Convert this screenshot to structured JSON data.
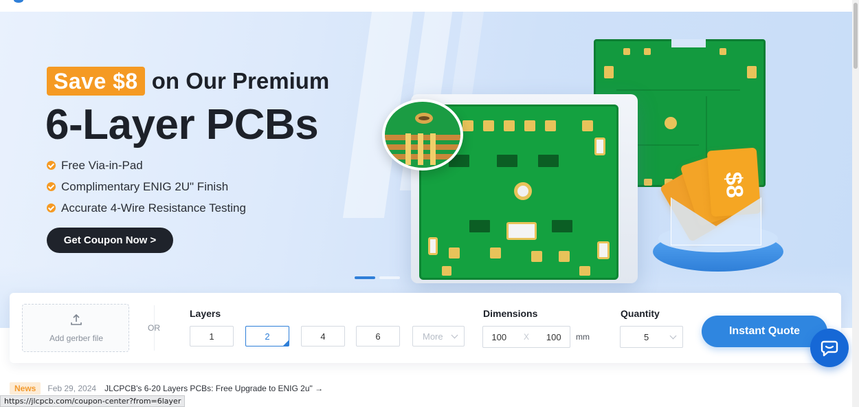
{
  "hero": {
    "badge": "Save $8",
    "headline_rest": "on Our Premium",
    "headline_main": "6-Layer PCBs",
    "features": [
      "Free Via-in-Pad",
      "Complimentary ENIG 2U\" Finish",
      "Accurate 4-Wire Resistance Testing"
    ],
    "cta_label": "Get Coupon Now >",
    "coupon_art_text": "$8"
  },
  "quote": {
    "upload_label": "Add gerber file",
    "or_label": "OR",
    "layers_label": "Layers",
    "layers": [
      "1",
      "2",
      "4",
      "6"
    ],
    "selected_layer": "2",
    "more_label": "More",
    "dimensions_label": "Dimensions",
    "dim_x": "100",
    "dim_sep": "X",
    "dim_y": "100",
    "unit": "mm",
    "quantity_label": "Quantity",
    "quantity": "5",
    "quote_button": "Instant Quote"
  },
  "news": {
    "badge": "News",
    "date": "Feb 29, 2024",
    "text": "JLCPCB's 6-20 Layers PCBs: Free Upgrade to ENIG 2u\" →"
  },
  "status_bar": {
    "url": "https://jlcpcb.com/coupon-center?from=6layer"
  },
  "colors": {
    "accent_orange": "#f59a23",
    "primary_blue": "#2f86e0",
    "dark_button": "#1f232b",
    "pcb_green": "#14a140"
  }
}
